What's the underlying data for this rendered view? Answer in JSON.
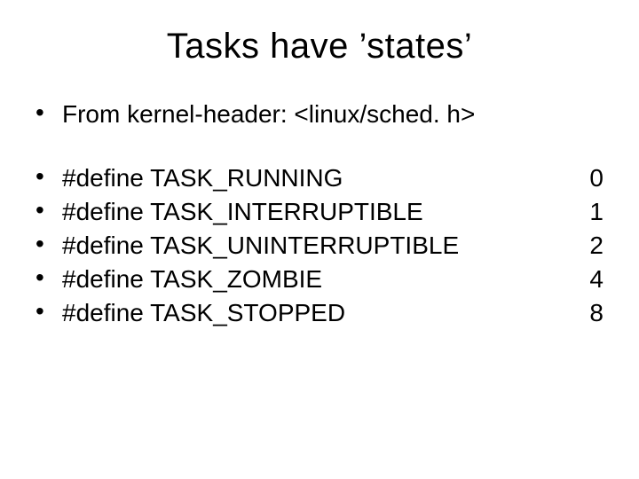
{
  "title": "Tasks have ’states’",
  "intro": "From  kernel-header: <linux/sched. h>",
  "defines": [
    {
      "text": "#define TASK_RUNNING",
      "value": "0"
    },
    {
      "text": "#define TASK_INTERRUPTIBLE",
      "value": "1"
    },
    {
      "text": "#define TASK_UNINTERRUPTIBLE",
      "value": "2"
    },
    {
      "text": "#define TASK_ZOMBIE",
      "value": "4"
    },
    {
      "text": "#define TASK_STOPPED",
      "value": "8"
    }
  ],
  "bullet_char": "•"
}
